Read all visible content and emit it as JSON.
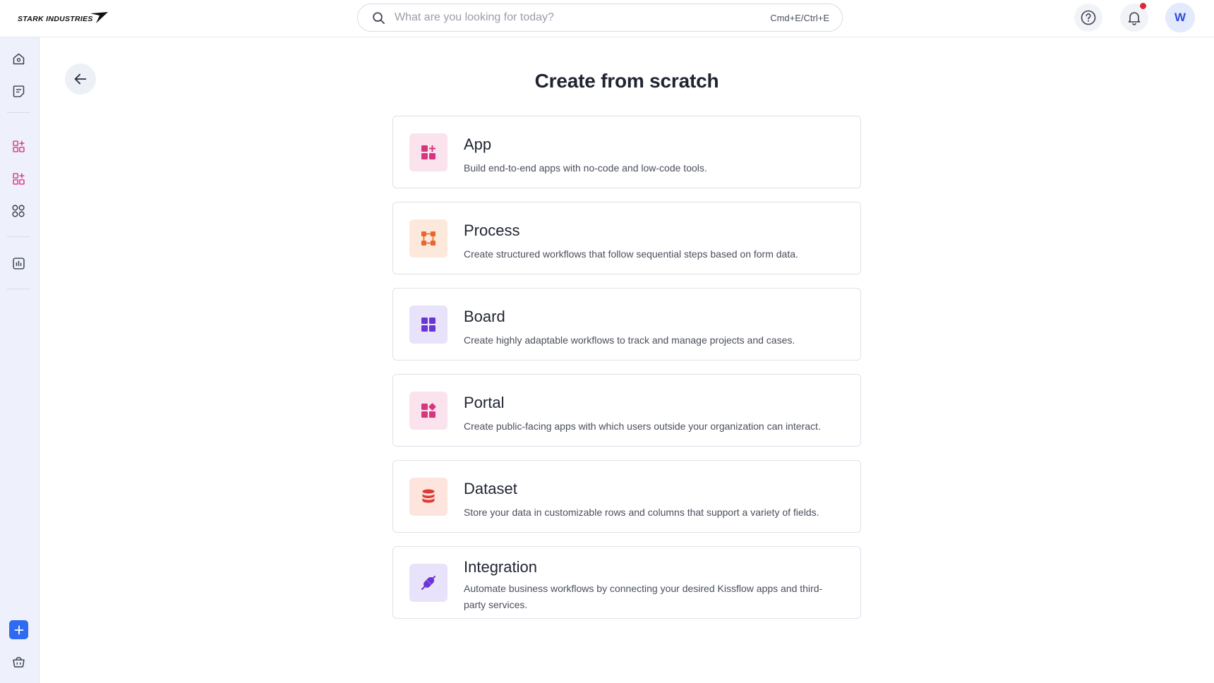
{
  "brand": {
    "logo_text": "STARK INDUSTRIES"
  },
  "search": {
    "placeholder": "What are you looking for today?",
    "shortcut": "Cmd+E/Ctrl+E"
  },
  "header": {
    "help_icon": "question-circle-icon",
    "notifications_icon": "bell-icon",
    "has_unread_notifications": true,
    "avatar_initial": "W"
  },
  "sidebar": {
    "items": [
      {
        "icon": "home-icon"
      },
      {
        "icon": "notes-icon"
      },
      {
        "icon": "apps-add-icon",
        "accent": "#e0388a"
      },
      {
        "icon": "apps-add-icon",
        "accent": "#e0388a"
      },
      {
        "icon": "grid-circles-icon"
      },
      {
        "icon": "analytics-icon"
      }
    ],
    "add_icon": "plus-icon",
    "bottom_icon": "basket-icon"
  },
  "main": {
    "back_icon": "arrow-left-icon",
    "title": "Create from scratch",
    "cards": [
      {
        "title": "App",
        "description": "Build end-to-end apps with no-code and low-code tools.",
        "icon": "app-add-icon",
        "icon_bg": "#fbe3ee",
        "icon_color": "#d6357f"
      },
      {
        "title": "Process",
        "description": "Create structured workflows that follow sequential steps based on form data.",
        "icon": "process-flow-icon",
        "icon_bg": "#fde8dc",
        "icon_color": "#e8672d"
      },
      {
        "title": "Board",
        "description": "Create highly adaptable workflows to track and manage projects and cases.",
        "icon": "board-grid-icon",
        "icon_bg": "#e9e2fb",
        "icon_color": "#6a35d6"
      },
      {
        "title": "Portal",
        "description": "Create public-facing apps with which users outside your organization can interact.",
        "icon": "portal-icon",
        "icon_bg": "#fbe3ee",
        "icon_color": "#d6357f"
      },
      {
        "title": "Dataset",
        "description": "Store your data in customizable rows and columns that support a variety of fields.",
        "icon": "database-icon",
        "icon_bg": "#fde4dd",
        "icon_color": "#dd3a35"
      },
      {
        "title": "Integration",
        "description": "Automate business workflows by connecting your desired Kissflow apps and third-party services.",
        "icon": "integration-link-icon",
        "icon_bg": "#e9e2fb",
        "icon_color": "#6a35d6"
      }
    ]
  }
}
